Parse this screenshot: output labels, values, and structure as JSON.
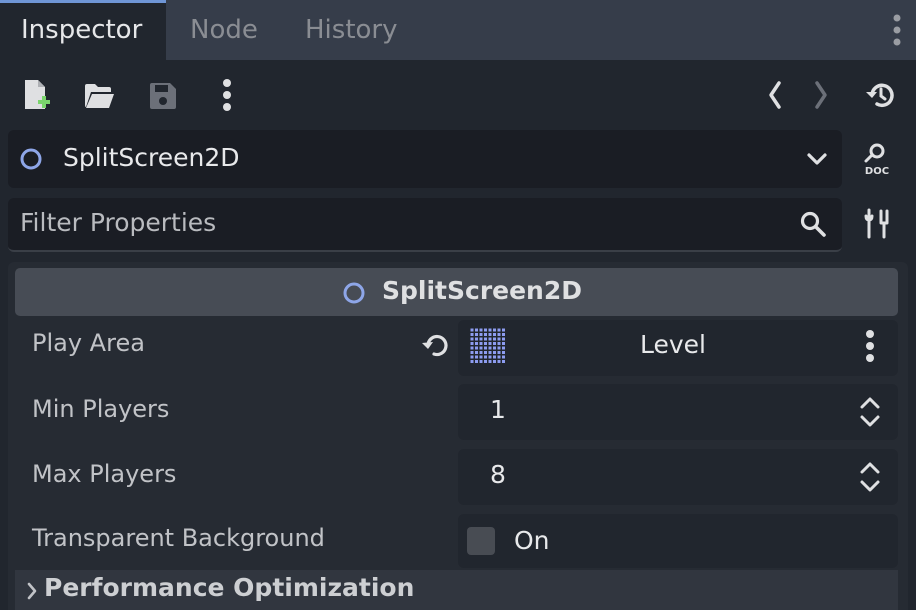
{
  "tabs": [
    {
      "label": "Inspector",
      "active": true
    },
    {
      "label": "Node",
      "active": false
    },
    {
      "label": "History",
      "active": false
    }
  ],
  "toolbar": {
    "icons": [
      "new-resource-icon",
      "open-folder-icon",
      "save-icon",
      "more-vertical-icon",
      "back-arrow-icon",
      "forward-arrow-icon",
      "history-icon"
    ]
  },
  "object_selector": {
    "name": "SplitScreen2D",
    "icon": "node-circle-icon"
  },
  "filter": {
    "placeholder": "Filter Properties"
  },
  "section": {
    "title": "SplitScreen2D",
    "icon": "node-circle-icon"
  },
  "properties": [
    {
      "label": "Play Area",
      "value": "Level",
      "kind": "resource"
    },
    {
      "label": "Min Players",
      "value": "1",
      "kind": "spin"
    },
    {
      "label": "Max Players",
      "value": "8",
      "kind": "spin"
    },
    {
      "label": "Transparent Background",
      "value": "On",
      "kind": "checkbox",
      "checked": false
    }
  ],
  "group": {
    "title": "Performance Optimization"
  },
  "colors": {
    "background": "#363d4a",
    "panel": "#21262e",
    "accent": "#6f96d6",
    "node_icon": "#8ea6e8",
    "add_badge": "#7bd66d"
  }
}
